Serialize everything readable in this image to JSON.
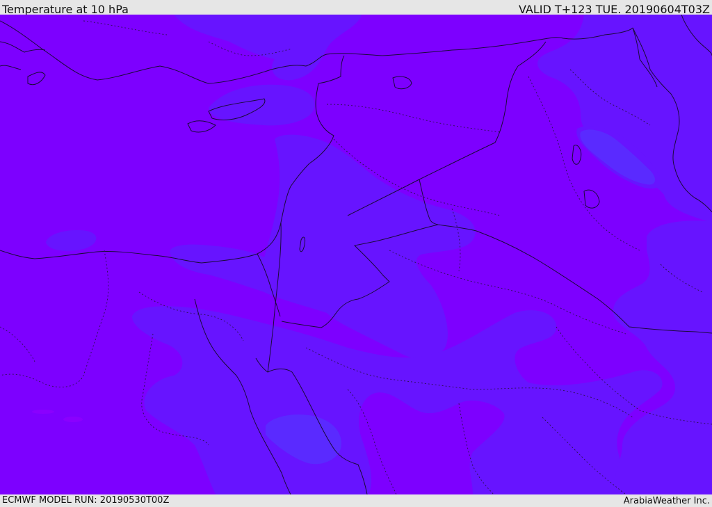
{
  "header": {
    "title": "Temperature at 10 hPa",
    "valid": "VALID T+123 TUE. 20190604T03Z"
  },
  "footer": {
    "model_run": "ECMWF MODEL RUN: 20190530T00Z",
    "credit": "ArabiaWeather Inc."
  },
  "map": {
    "field": "temperature",
    "level": "10 hPa",
    "colors": {
      "warm_fill": "#7d00ff",
      "mid_fill": "#6714ff",
      "cool_fill": "#5a2aff",
      "coast_line": "#1a0a3a",
      "border_line": "#2a1050"
    }
  }
}
